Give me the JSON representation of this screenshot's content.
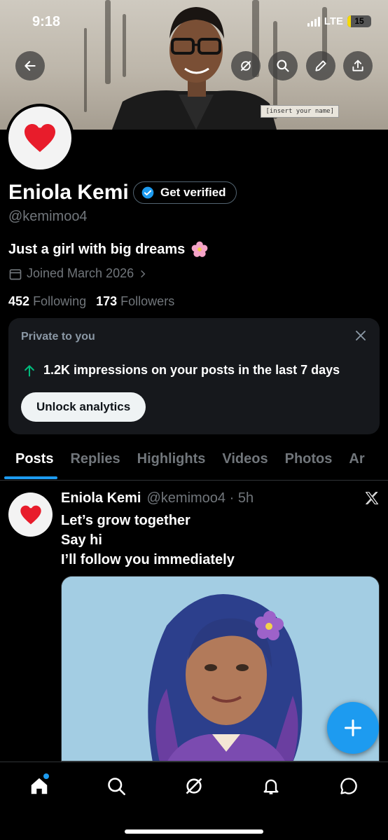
{
  "status_bar": {
    "time": "9:18",
    "network": "LTE",
    "battery": "15",
    "battery_level": 0.15
  },
  "banner": {
    "caption": "[insert your name]"
  },
  "profile": {
    "name": "Eniola Kemi",
    "verify_label": "Get verified",
    "handle": "@kemimoo4",
    "bio": "Just a girl with big dreams",
    "bio_emoji": "🌸",
    "joined": "Joined March 2026",
    "following_count": "452",
    "following_label": "Following",
    "followers_count": "173",
    "followers_label": "Followers"
  },
  "analytics_card": {
    "title": "Private to you",
    "stat": "1.2K impressions on your posts in the last 7 days",
    "button": "Unlock analytics"
  },
  "tabs": [
    "Posts",
    "Replies",
    "Highlights",
    "Videos",
    "Photos",
    "Ar"
  ],
  "post": {
    "name": "Eniola Kemi",
    "handle_time": "@kemimoo4 · 5h",
    "lines": [
      "Let’s grow together",
      "Say hi",
      "I’ll follow you immediately"
    ]
  },
  "colors": {
    "accent": "#1d9bf0",
    "background": "#000000",
    "muted": "#71767b",
    "card": "#16181c"
  }
}
